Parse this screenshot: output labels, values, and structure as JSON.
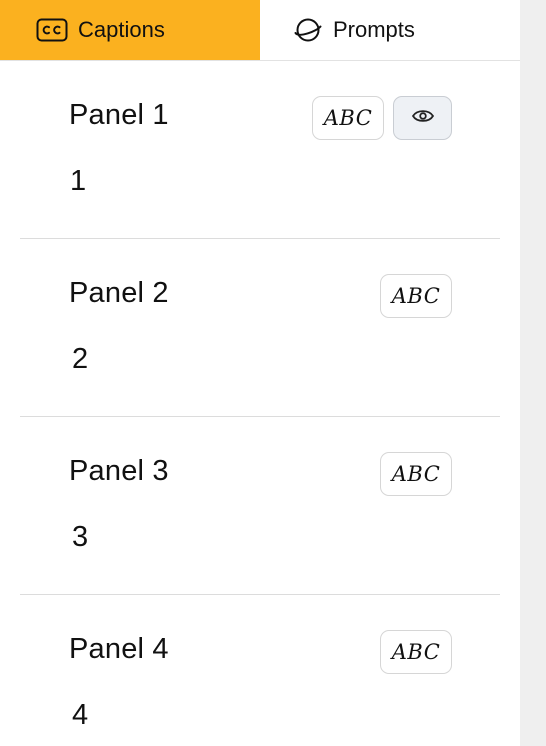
{
  "tabs": {
    "captions": {
      "label": "Captions",
      "icon": "closed-captions-icon",
      "active": true,
      "color": "#fbb11f"
    },
    "prompts": {
      "label": "Prompts",
      "icon": "planet-icon",
      "active": false
    }
  },
  "panels": [
    {
      "title": "Panel 1",
      "value": "1",
      "abc_label": "ABC",
      "has_eye": true
    },
    {
      "title": "Panel 2",
      "value": "2",
      "abc_label": "ABC",
      "has_eye": false
    },
    {
      "title": "Panel 3",
      "value": "3",
      "abc_label": "ABC",
      "has_eye": false
    },
    {
      "title": "Panel 4",
      "value": "4",
      "abc_label": "ABC",
      "has_eye": false
    }
  ]
}
